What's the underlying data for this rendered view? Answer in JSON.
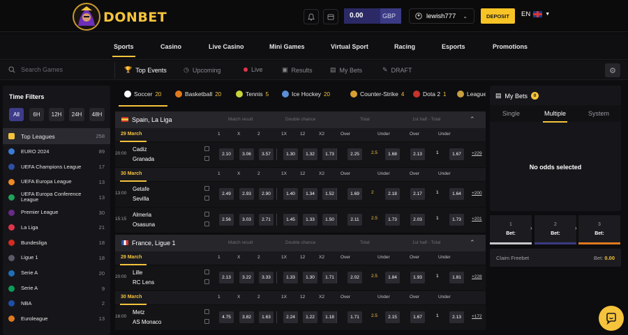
{
  "brand": {
    "name": "DONBET"
  },
  "header": {
    "balance": "0.00",
    "currency": "GBP",
    "username": "lewish777",
    "deposit_label": "DEPOSIT",
    "language": "EN"
  },
  "mainnav": [
    "Sports",
    "Casino",
    "Live Casino",
    "Mini Games",
    "Virtual Sport",
    "Racing",
    "Esports",
    "Promotions"
  ],
  "subnav": {
    "search_placeholder": "Search Games",
    "tabs": [
      "Top Events",
      "Upcoming",
      "Live",
      "Results",
      "My Bets",
      "DRAFT"
    ]
  },
  "time_filters": {
    "title": "Time Filters",
    "options": [
      "All",
      "6H",
      "12H",
      "24H",
      "48H"
    ],
    "selected": "All"
  },
  "leagues": [
    {
      "name": "Top Leagues",
      "count": "258",
      "color": "#f5c33c"
    },
    {
      "name": "EURO 2024",
      "count": "89",
      "color": "#3a7bd5"
    },
    {
      "name": "UEFA Champions League",
      "count": "17",
      "color": "#2d4fa3"
    },
    {
      "name": "UEFA Europa League",
      "count": "13",
      "color": "#f08a24"
    },
    {
      "name": "UEFA Europa Conference League",
      "count": "13",
      "color": "#1fa35a"
    },
    {
      "name": "Premier League",
      "count": "30",
      "color": "#6a2a8c"
    },
    {
      "name": "La Liga",
      "count": "21",
      "color": "#e0344b"
    },
    {
      "name": "Bundesliga",
      "count": "18",
      "color": "#d52b1e"
    },
    {
      "name": "Ligue 1",
      "count": "18",
      "color": "#5a5a6a"
    },
    {
      "name": "Serie A",
      "count": "20",
      "color": "#1e6fb8"
    },
    {
      "name": "Serie A",
      "count": "9",
      "color": "#0b9c5a"
    },
    {
      "name": "NBA",
      "count": "2",
      "color": "#1d4fa8"
    },
    {
      "name": "Euroleague",
      "count": "13",
      "color": "#e07a1f"
    }
  ],
  "sports": [
    {
      "name": "Soccer",
      "count": "20",
      "color": "#ffffff"
    },
    {
      "name": "Basketball",
      "count": "20",
      "color": "#e07a1f"
    },
    {
      "name": "Tennis",
      "count": "5",
      "color": "#c8d43a"
    },
    {
      "name": "Ice Hockey",
      "count": "20",
      "color": "#5a8fd8"
    },
    {
      "name": "Counter-Strike",
      "count": "4",
      "color": "#d8a030"
    },
    {
      "name": "Dota 2",
      "count": "1",
      "color": "#c8342a"
    },
    {
      "name": "League of Legends",
      "count": "",
      "color": "#c8a040"
    }
  ],
  "market_headers": [
    "Match result",
    "Double chance",
    "Total",
    "1st half - Total"
  ],
  "column_headers": [
    "1",
    "X",
    "2",
    "1X",
    "12",
    "X2",
    "Over",
    "Under",
    "Over",
    "Under"
  ],
  "leagues_blocks": [
    {
      "name": "Spain, La Liga",
      "dates": [
        {
          "date": "29 March",
          "matches": [
            {
              "time": "20:00",
              "team1": "Cadiz",
              "team2": "Granada",
              "odds": [
                "2.10",
                "3.06",
                "3.57",
                "1.30",
                "1.32",
                "1.73",
                "2.25",
                "2.5",
                "1.68",
                "2.13",
                "1",
                "1.67"
              ],
              "more": "+229"
            }
          ]
        },
        {
          "date": "30 March",
          "matches": [
            {
              "time": "13:00",
              "team1": "Getafe",
              "team2": "Sevilla",
              "odds": [
                "2.49",
                "2.93",
                "2.90",
                "1.40",
                "1.34",
                "1.52",
                "1.69",
                "2",
                "2.18",
                "2.17",
                "1",
                "1.64"
              ],
              "more": "+200"
            },
            {
              "time": "15:15",
              "team1": "Almeria",
              "team2": "Osasuna",
              "odds": [
                "2.56",
                "3.03",
                "2.71",
                "1.45",
                "1.33",
                "1.50",
                "2.11",
                "2.5",
                "1.73",
                "2.03",
                "1",
                "1.73"
              ],
              "more": "+201"
            }
          ]
        }
      ]
    },
    {
      "name": "France, Ligue 1",
      "dates": [
        {
          "date": "29 March",
          "matches": [
            {
              "time": "20:00",
              "team1": "Lille",
              "team2": "RC Lens",
              "odds": [
                "2.13",
                "3.22",
                "3.33",
                "1.33",
                "1.30",
                "1.71",
                "2.02",
                "2.5",
                "1.84",
                "1.93",
                "1",
                "1.81"
              ],
              "more": "+228"
            }
          ]
        },
        {
          "date": "30 March",
          "matches": [
            {
              "time": "16:00",
              "team1": "Metz",
              "team2": "AS Monaco",
              "odds": [
                "4.75",
                "3.82",
                "1.63",
                "2.24",
                "1.22",
                "1.18",
                "1.71",
                "2.5",
                "2.15",
                "1.67",
                "1",
                "2.13"
              ],
              "more": "+172"
            }
          ]
        }
      ]
    }
  ],
  "betslip": {
    "title": "My Bets",
    "badge": "0",
    "tabs": [
      "Single",
      "Multiple",
      "System"
    ],
    "active_tab": "Multiple",
    "empty_text": "No odds selected",
    "slots": [
      {
        "num": "1",
        "label": "Bet:",
        "color": "#c8c8cc"
      },
      {
        "num": "2",
        "label": "Bet:",
        "color": "#3b3a84"
      },
      {
        "num": "3",
        "label": "Bet:",
        "color": "#e07a1f"
      }
    ],
    "freebet_label": "Claim Freebet",
    "bet_label": "Bet:",
    "bet_value": "0.00"
  }
}
